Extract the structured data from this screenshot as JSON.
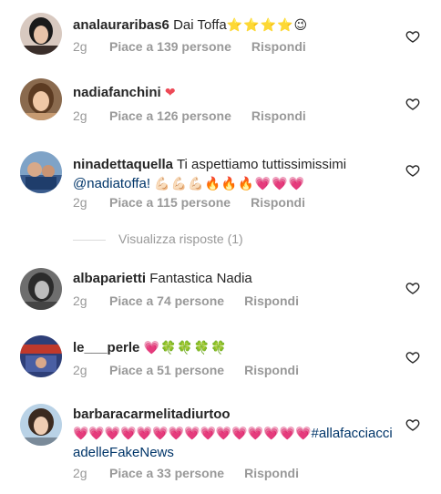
{
  "comments": [
    {
      "username": "analauraribas6",
      "text": "Dai Toffa",
      "emoji": "⭐⭐⭐⭐😉",
      "time": "2g",
      "likes": "Piace a 139 persone",
      "reply": "Rispondi"
    },
    {
      "username": "nadiafanchini",
      "text": "",
      "emoji": "❤",
      "time": "2g",
      "likes": "Piace a 126 persone",
      "reply": "Rispondi"
    },
    {
      "username": "ninadettaquella",
      "text": "Ti aspettiamo tuttissimissimi",
      "mention": "@nadiatoffa!",
      "emoji": "💪🏻💪🏻💪🏻🔥🔥🔥💗💗💗",
      "time": "2g",
      "likes": "Piace a 115 persone",
      "reply": "Rispondi"
    },
    {
      "username": "albaparietti",
      "text": "Fantastica Nadia",
      "emoji": "",
      "time": "2g",
      "likes": "Piace a 74 persone",
      "reply": "Rispondi"
    },
    {
      "username": "le___perle",
      "text": "",
      "emoji": "💗🍀🍀🍀🍀",
      "time": "2g",
      "likes": "Piace a 51 persone",
      "reply": "Rispondi"
    },
    {
      "username": "barbaracarmelitadiurtoo",
      "text": "",
      "emoji": "💗💗💗💗💗💗💗💗💗💗💗💗💗💗💗",
      "hashtag": "#allafacciacciadelleFakeNews",
      "time": "2g",
      "likes": "Piace a 33 persone",
      "reply": "Rispondi"
    }
  ],
  "view_replies": "Visualizza risposte (1)",
  "icons": {
    "like": "heart-outline-icon"
  },
  "colors": {
    "meta": "#999999",
    "mention": "#003569",
    "heart": "#ed4956"
  }
}
